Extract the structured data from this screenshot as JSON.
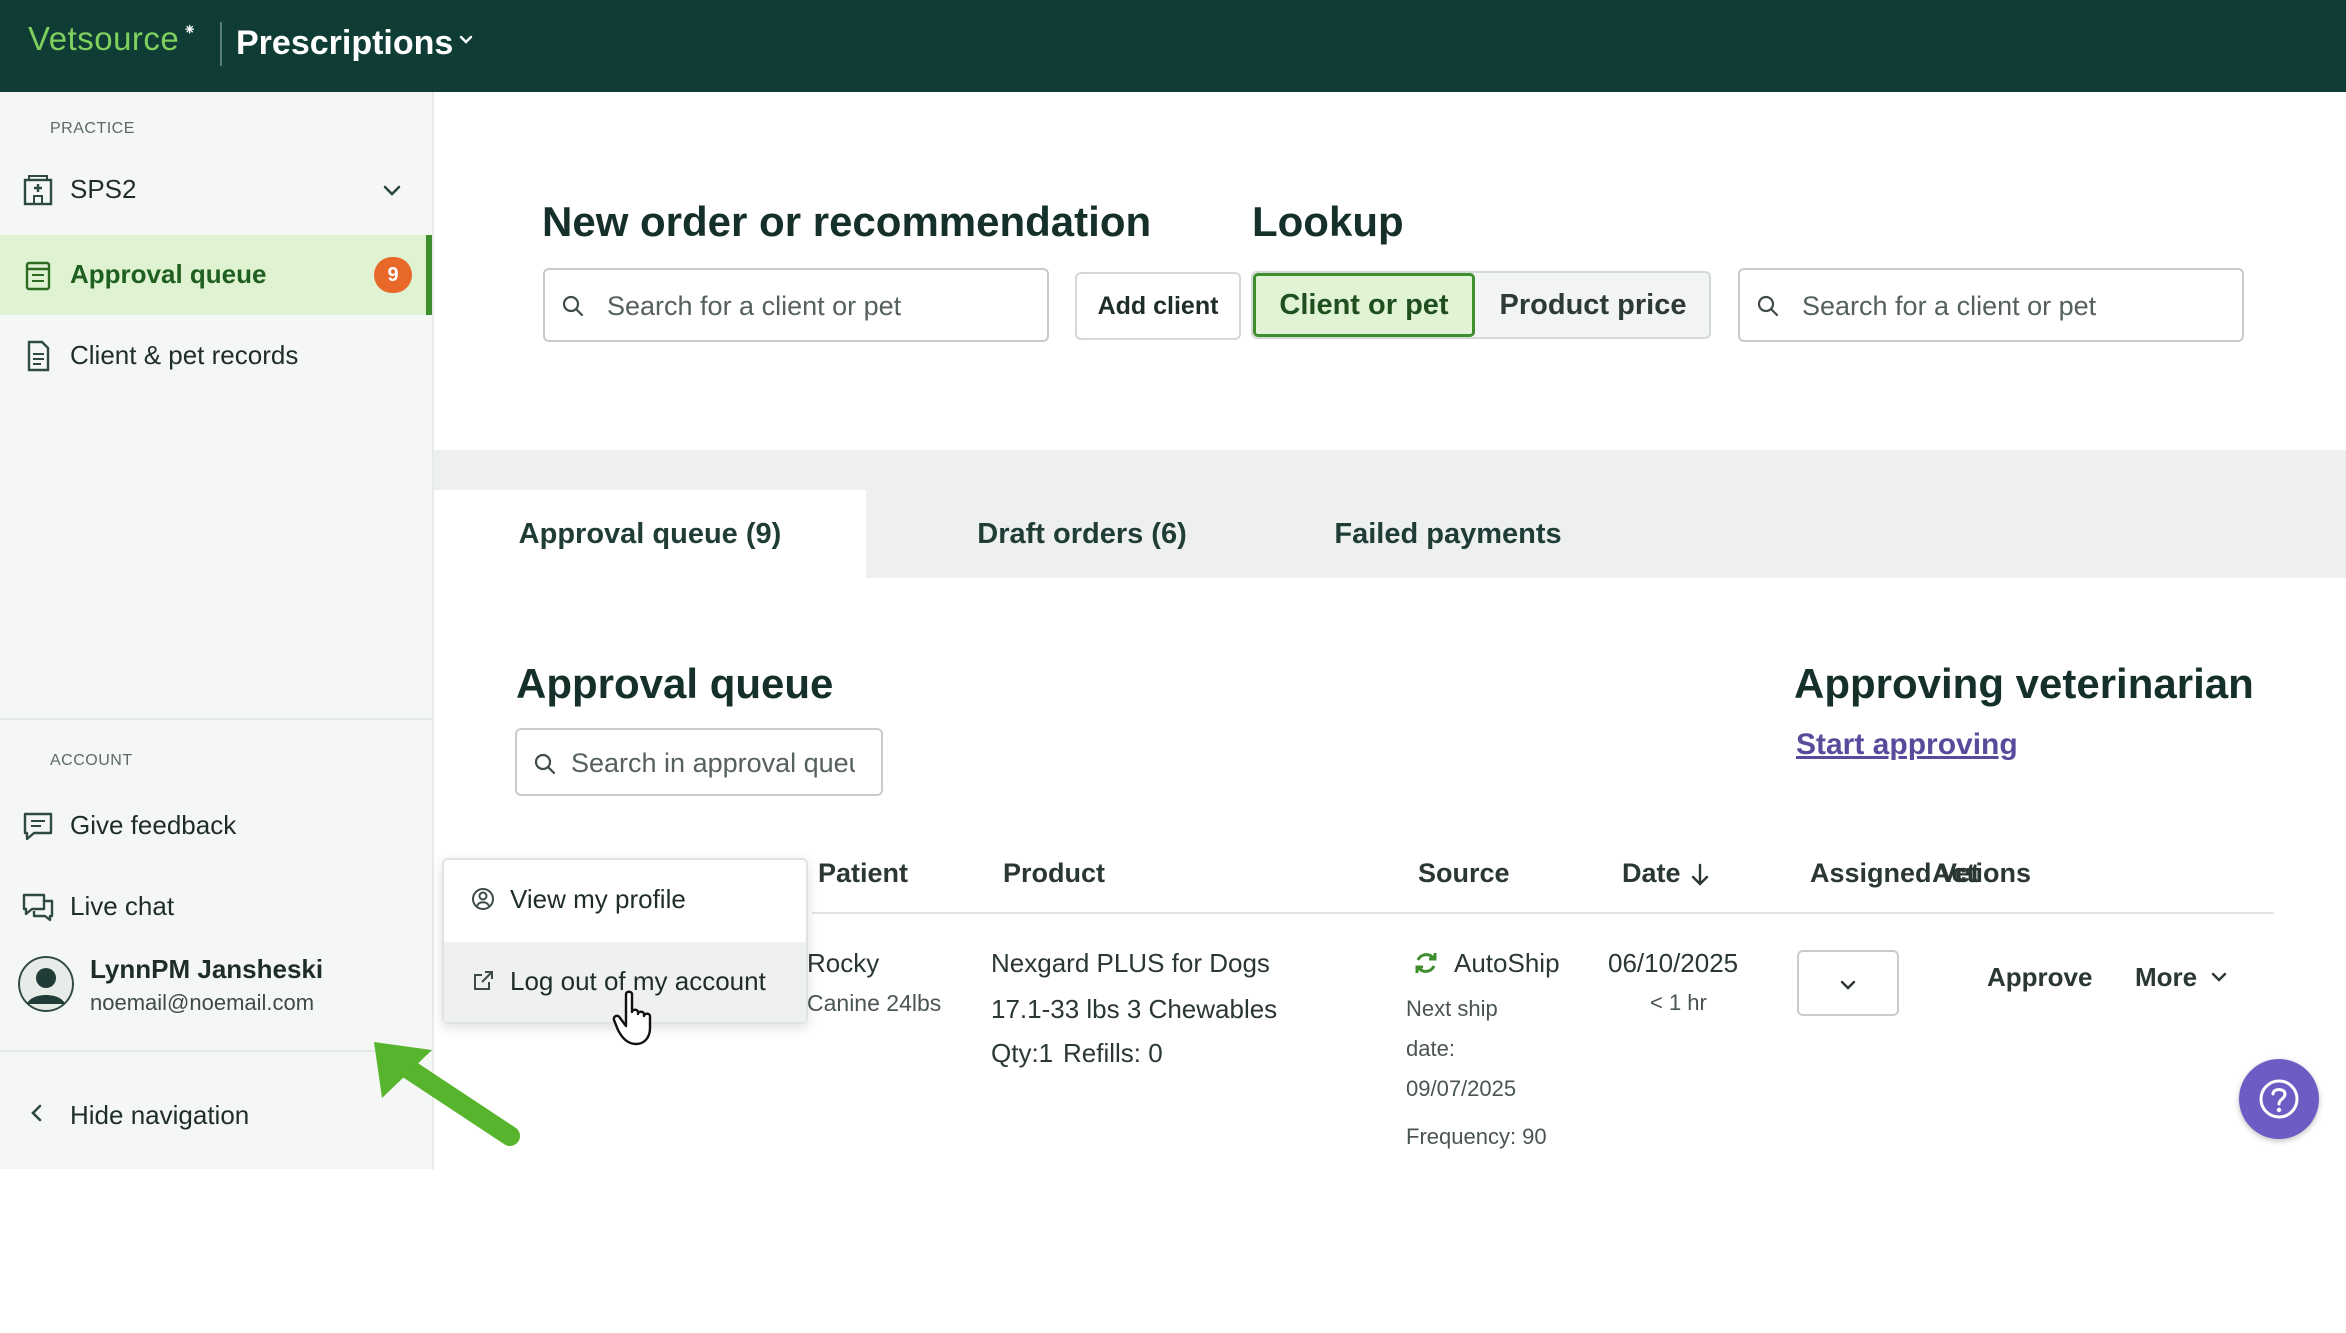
{
  "header": {
    "logo": "Vetsource",
    "app_title": "Prescriptions"
  },
  "sidebar": {
    "practice_label": "PRACTICE",
    "practice_select": "SPS2",
    "items": [
      {
        "label": "Approval queue",
        "badge": "9"
      },
      {
        "label": "Client & pet records"
      }
    ],
    "account_label": "ACCOUNT",
    "account_items": [
      {
        "label": "Give feedback"
      },
      {
        "label": "Live chat"
      }
    ],
    "user": {
      "name": "LynnPM Jansheski",
      "email": "noemail@noemail.com"
    },
    "hide_nav": "Hide navigation"
  },
  "new_order": {
    "title": "New order or recommendation",
    "search_placeholder": "Search for a client or pet",
    "add_client": "Add client"
  },
  "lookup": {
    "title": "Lookup",
    "options": [
      "Client or pet",
      "Product price"
    ],
    "selected": "Client or pet",
    "search_placeholder": "Search for a client or pet"
  },
  "tabs": [
    {
      "label": "Approval queue (9)"
    },
    {
      "label": "Draft orders (6)"
    },
    {
      "label": "Failed payments"
    }
  ],
  "queue": {
    "title": "Approval queue",
    "search_placeholder": "Search in approval queue",
    "vet_title": "Approving veterinarian",
    "vet_link": "Start approving",
    "columns": [
      "Patient",
      "Product",
      "Source",
      "Date",
      "Assigned Vet",
      "Actions"
    ],
    "row": {
      "patient_name": "Rocky",
      "patient_detail": "Canine 24lbs",
      "product_line1": "Nexgard PLUS for Dogs",
      "product_line2": "17.1-33 lbs 3 Chewables",
      "qty": "Qty:1",
      "refills": "Refills: 0",
      "source": "AutoShip",
      "next_ship_1": "Next ship",
      "next_ship_2": "date:",
      "next_ship_date": "09/07/2025",
      "frequency": "Frequency: 90",
      "date": "06/10/2025",
      "age": "< 1 hr",
      "approve": "Approve",
      "more": "More"
    }
  },
  "popup_menu": {
    "items": [
      "View my profile",
      "Log out of my account"
    ]
  },
  "colors": {
    "topbar": "#0f3d35",
    "accent_green": "#3e8e2e",
    "badge": "#e8682a",
    "link_purple": "#5a4a9c",
    "help_button": "#6f5bc4"
  }
}
